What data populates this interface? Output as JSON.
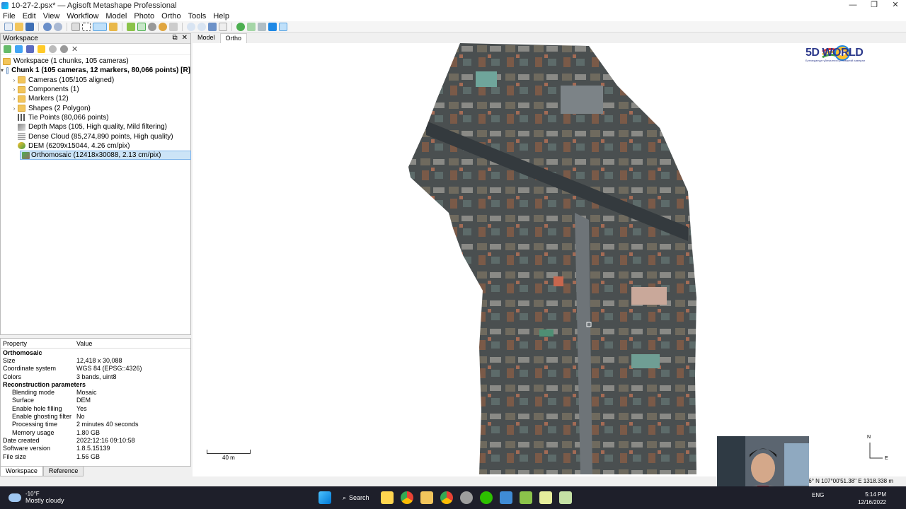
{
  "window": {
    "title": "10-27-2.psx* — Agisoft Metashape Professional",
    "controls": [
      "—",
      "❐",
      "✕"
    ]
  },
  "menu": [
    "File",
    "Edit",
    "View",
    "Workflow",
    "Model",
    "Photo",
    "Ortho",
    "Tools",
    "Help"
  ],
  "workspace": {
    "header": "Workspace",
    "root": "Workspace (1 chunks, 105 cameras)",
    "chunk": "Chunk 1 (105 cameras, 12 markers, 80,066 points) [R]",
    "items": [
      {
        "label": "Cameras (105/105 aligned)",
        "expandable": true,
        "icon": "folder-icon"
      },
      {
        "label": "Components (1)",
        "expandable": true,
        "icon": "folder-icon"
      },
      {
        "label": "Markers (12)",
        "expandable": true,
        "icon": "folder-icon"
      },
      {
        "label": "Shapes (2 Polygon)",
        "expandable": true,
        "icon": "folder-icon"
      },
      {
        "label": "Tie Points (80,066 points)",
        "expandable": false,
        "icon": "tie-points-icon"
      },
      {
        "label": "Depth Maps (105, High quality, Mild filtering)",
        "expandable": false,
        "icon": "depth-maps-icon"
      },
      {
        "label": "Dense Cloud (85,274,890 points, High quality)",
        "expandable": false,
        "icon": "dense-cloud-icon"
      },
      {
        "label": "DEM (6209x15044, 4.26 cm/pix)",
        "expandable": false,
        "icon": "dem-icon"
      },
      {
        "label": "Orthomosaic (12418x30088, 2.13 cm/pix)",
        "expandable": false,
        "icon": "orthomosaic-icon",
        "selected": true
      }
    ]
  },
  "properties": {
    "col_property": "Property",
    "col_value": "Value",
    "section1": "Orthomosaic",
    "rows1": [
      {
        "k": "Size",
        "v": "12,418 x 30,088"
      },
      {
        "k": "Coordinate system",
        "v": "WGS 84 (EPSG::4326)"
      },
      {
        "k": "Colors",
        "v": "3 bands, uint8"
      }
    ],
    "section2": "Reconstruction parameters",
    "rows2": [
      {
        "k": "Blending mode",
        "v": "Mosaic"
      },
      {
        "k": "Surface",
        "v": "DEM"
      },
      {
        "k": "Enable hole filling",
        "v": "Yes"
      },
      {
        "k": "Enable ghosting filter",
        "v": "No"
      },
      {
        "k": "Processing time",
        "v": "2 minutes 40 seconds"
      },
      {
        "k": "Memory usage",
        "v": "1.80 GB"
      }
    ],
    "rows3": [
      {
        "k": "Date created",
        "v": "2022:12:16 09:10:58"
      },
      {
        "k": "Software version",
        "v": "1.8.5.15139"
      },
      {
        "k": "File size",
        "v": "1.56 GB"
      }
    ]
  },
  "bottom_tabs": [
    "Workspace",
    "Reference"
  ],
  "view_tabs": [
    "Model",
    "Ortho"
  ],
  "viewport": {
    "scale_label": "40 m",
    "compass_n": "N",
    "compass_e": "E",
    "coords": "76° N  107°00'51.38\" E  1318.338 m"
  },
  "logo": {
    "text": "5D WORLD",
    "subtitle": "Бүтээгдэхүүн үйлчилгээ Бүтээмжтэй хамтрал",
    "colors": [
      "#e53935",
      "#fbc02d",
      "#43a047",
      "#1e88e5"
    ]
  },
  "taskbar": {
    "weather_temp": "-10°F",
    "weather_desc": "Mostly cloudy",
    "search_label": "Search",
    "lang": "ENG",
    "time": "5:14 PM",
    "date": "12/16/2022"
  }
}
